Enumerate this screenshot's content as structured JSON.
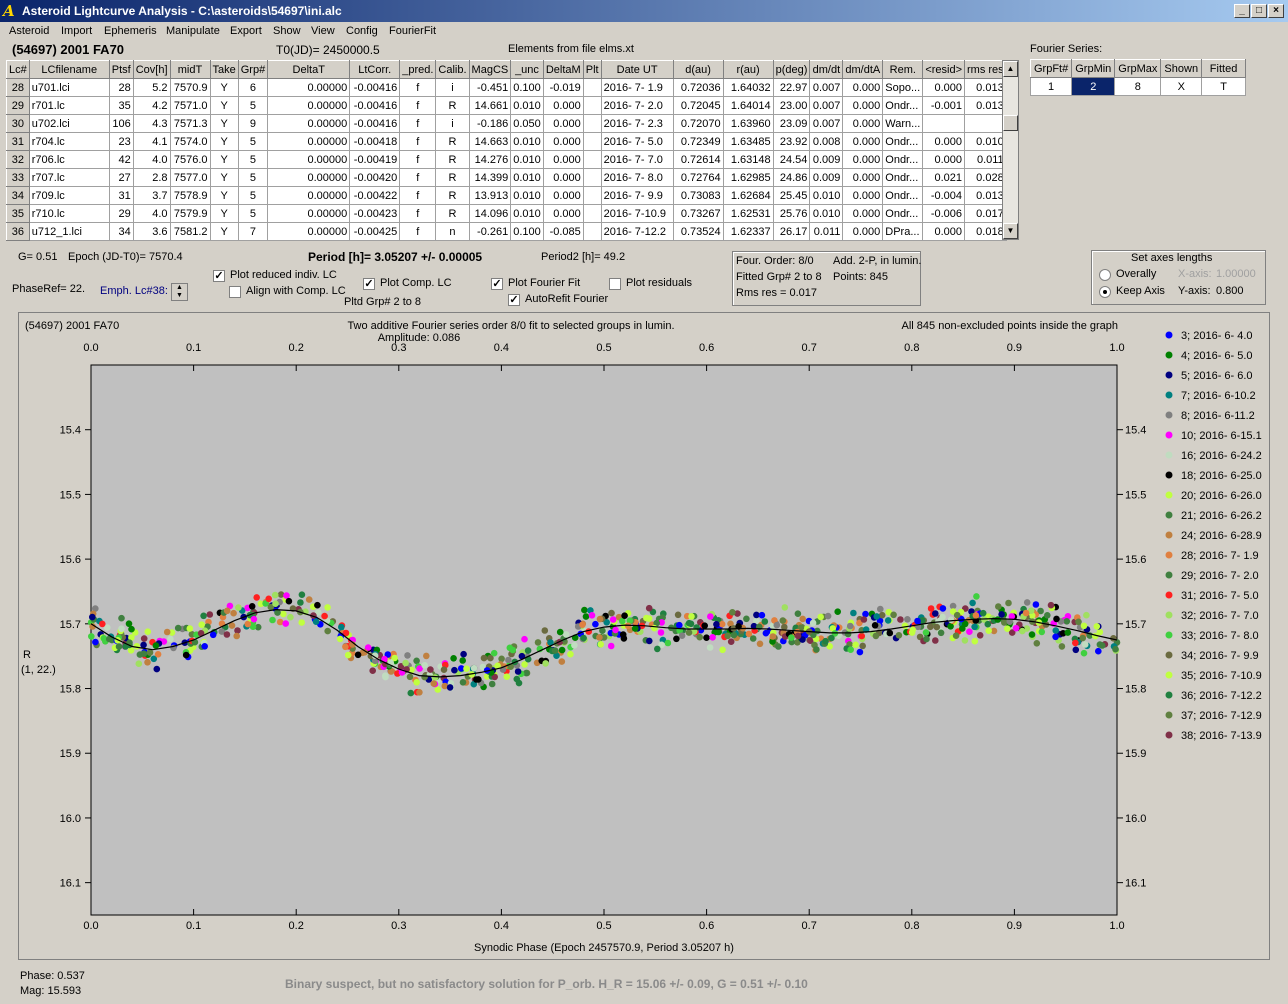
{
  "window": {
    "title": "Asteroid Lightcurve Analysis - C:\\asteroids\\54697\\ini.alc",
    "app_icon": "alc-app-icon",
    "buttons": [
      "_",
      "□",
      "×"
    ]
  },
  "menu": [
    "Asteroid",
    "Import",
    "Ephemeris",
    "Manipulate",
    "Export",
    "Show",
    "View",
    "Config",
    "FourierFit"
  ],
  "header": {
    "object": "(54697) 2001 FA70",
    "t0": "T0(JD)= 2450000.5",
    "elements": "Elements from file elms.xt",
    "fourier_label": "Fourier Series:"
  },
  "lc_table": {
    "columns": [
      "Lc#",
      "LCfilename",
      "Ptsf",
      "Cov[h]",
      "midT",
      "Take",
      "Grp#",
      "DeltaT",
      "LtCorr.",
      "_pred.",
      "Calib.",
      "MagCS",
      "_unc",
      "DeltaM",
      "Plt",
      "Date UT",
      "d(au)",
      "r(au)",
      "p(deg)",
      "dm/dt",
      "dm/dtA",
      "Rem.",
      "<resid>",
      "rms res"
    ],
    "rows": [
      [
        "28",
        "u701.lci",
        "28",
        "5.2",
        "7570.9",
        "Y",
        "6",
        "0.00000",
        "-0.00416",
        "f",
        "i",
        "-0.451",
        "0.100",
        "-0.019",
        "",
        "2016- 7- 1.9",
        "0.72036",
        "1.64032",
        "22.97",
        "0.007",
        "0.000",
        "Sopo...",
        "0.000",
        "0.013"
      ],
      [
        "29",
        "r701.lc",
        "35",
        "4.2",
        "7571.0",
        "Y",
        "5",
        "0.00000",
        "-0.00416",
        "f",
        "R",
        "14.661",
        "0.010",
        "0.000",
        "",
        "2016- 7- 2.0",
        "0.72045",
        "1.64014",
        "23.00",
        "0.007",
        "0.000",
        "Ondr...",
        "-0.001",
        "0.013"
      ],
      [
        "30",
        "u702.lci",
        "106",
        "4.3",
        "7571.3",
        "Y",
        "9",
        "0.00000",
        "-0.00416",
        "f",
        "i",
        "-0.186",
        "0.050",
        "0.000",
        "",
        "2016- 7- 2.3",
        "0.72070",
        "1.63960",
        "23.09",
        "0.007",
        "0.000",
        "Warn...",
        "",
        ""
      ],
      [
        "31",
        "r704.lc",
        "23",
        "4.1",
        "7574.0",
        "Y",
        "5",
        "0.00000",
        "-0.00418",
        "f",
        "R",
        "14.663",
        "0.010",
        "0.000",
        "",
        "2016- 7- 5.0",
        "0.72349",
        "1.63485",
        "23.92",
        "0.008",
        "0.000",
        "Ondr...",
        "0.000",
        "0.010"
      ],
      [
        "32",
        "r706.lc",
        "42",
        "4.0",
        "7576.0",
        "Y",
        "5",
        "0.00000",
        "-0.00419",
        "f",
        "R",
        "14.276",
        "0.010",
        "0.000",
        "",
        "2016- 7- 7.0",
        "0.72614",
        "1.63148",
        "24.54",
        "0.009",
        "0.000",
        "Ondr...",
        "0.000",
        "0.011"
      ],
      [
        "33",
        "r707.lc",
        "27",
        "2.8",
        "7577.0",
        "Y",
        "5",
        "0.00000",
        "-0.00420",
        "f",
        "R",
        "14.399",
        "0.010",
        "0.000",
        "",
        "2016- 7- 8.0",
        "0.72764",
        "1.62985",
        "24.86",
        "0.009",
        "0.000",
        "Ondr...",
        "0.021",
        "0.028"
      ],
      [
        "34",
        "r709.lc",
        "31",
        "3.7",
        "7578.9",
        "Y",
        "5",
        "0.00000",
        "-0.00422",
        "f",
        "R",
        "13.913",
        "0.010",
        "0.000",
        "",
        "2016- 7- 9.9",
        "0.73083",
        "1.62684",
        "25.45",
        "0.010",
        "0.000",
        "Ondr...",
        "-0.004",
        "0.013"
      ],
      [
        "35",
        "r710.lc",
        "29",
        "4.0",
        "7579.9",
        "Y",
        "5",
        "0.00000",
        "-0.00423",
        "f",
        "R",
        "14.096",
        "0.010",
        "0.000",
        "",
        "2016- 7-10.9",
        "0.73267",
        "1.62531",
        "25.76",
        "0.010",
        "0.000",
        "Ondr...",
        "-0.006",
        "0.017"
      ],
      [
        "36",
        "u712_1.lci",
        "34",
        "3.6",
        "7581.2",
        "Y",
        "7",
        "0.00000",
        "-0.00425",
        "f",
        "n",
        "-0.261",
        "0.100",
        "-0.085",
        "",
        "2016- 7-12.2",
        "0.73524",
        "1.62337",
        "26.17",
        "0.011",
        "0.000",
        "DPra...",
        "0.000",
        "0.018"
      ]
    ]
  },
  "fourier_table": {
    "columns": [
      "GrpFt#",
      "GrpMin",
      "GrpMax",
      "Shown",
      "Fitted"
    ],
    "row": [
      "1",
      "2",
      "8",
      "X",
      "T"
    ]
  },
  "controls": {
    "g": "G= 0.51",
    "epoch": "Epoch (JD-T0)= 7570.4",
    "period": "Period [h]= 3.05207 +/- 0.00005",
    "period2": "Period2 [h]= 49.2",
    "phaseref": "PhaseRef= 22.",
    "emph": "Emph. Lc#38:",
    "plot_reduced": "Plot reduced indiv. LC",
    "align": "Align with Comp. LC",
    "plot_comp": "Plot Comp. LC",
    "pltd_grp": "Pltd Grp#  2   to   8",
    "plot_fourier": "Plot Fourier Fit",
    "autorefit": "AutoRefit Fourier",
    "plot_resid": "Plot residuals",
    "plot_reduced_checked": true,
    "align_checked": false,
    "plot_comp_checked": true,
    "plot_fourier_checked": true,
    "autorefit_checked": true,
    "plot_resid_checked": false
  },
  "fit_info": {
    "order": "Four. Order:  8/0",
    "add": "Add. 2-P, in lumin.",
    "fitted": "Fitted Grp# 2 to 8",
    "points": "Points: 845",
    "rms": "Rms res      = 0.017"
  },
  "axes_box": {
    "title": "Set axes lengths",
    "overally": "Overally",
    "keep": "Keep Axis",
    "xaxis_label": "X-axis:",
    "xaxis_val": "1.00000",
    "yaxis_label": "Y-axis:",
    "yaxis_val": "0.800",
    "selected": "keep"
  },
  "status": {
    "phase": "Phase:  0.537",
    "mag": "Mag:    15.593",
    "message": "Binary suspect, but no satisfactory solution for P_orb.  H_R = 15.06 +/- 0.09, G = 0.51 +/- 0.10"
  },
  "chart_data": {
    "type": "scatter",
    "title": "(54697) 2001 FA70",
    "subtitle": "Two additive Fourier series order 8/0 fit to selected groups in lumin.",
    "amplitude": "Amplitude: 0.086",
    "note": "All 845 non-excluded points inside the graph",
    "xlabel": "Synodic Phase (Epoch 2457570.9, Period 3.05207 h)",
    "ylabel": "R",
    "ylabel2": "(1, 22.)",
    "xlim": [
      0,
      1
    ],
    "ylim": [
      15.3,
      16.15
    ],
    "y_inverted": true,
    "x_ticks": [
      "0.0",
      "0.1",
      "0.2",
      "0.3",
      "0.4",
      "0.5",
      "0.6",
      "0.7",
      "0.8",
      "0.9",
      "1.0"
    ],
    "y_ticks": [
      "15.4",
      "15.5",
      "15.6",
      "15.7",
      "15.8",
      "15.9",
      "16.0",
      "16.1"
    ],
    "fit_curve": {
      "x": [
        0.0,
        0.02,
        0.04,
        0.06,
        0.08,
        0.1,
        0.12,
        0.14,
        0.16,
        0.18,
        0.2,
        0.22,
        0.24,
        0.26,
        0.28,
        0.3,
        0.32,
        0.34,
        0.36,
        0.38,
        0.4,
        0.42,
        0.44,
        0.46,
        0.48,
        0.5,
        0.52,
        0.54,
        0.56,
        0.58,
        0.6,
        0.62,
        0.64,
        0.66,
        0.68,
        0.7,
        0.72,
        0.74,
        0.76,
        0.78,
        0.8,
        0.82,
        0.84,
        0.86,
        0.88,
        0.9,
        0.92,
        0.94,
        0.96,
        0.98,
        1.0
      ],
      "y": [
        15.7,
        15.72,
        15.735,
        15.74,
        15.735,
        15.725,
        15.71,
        15.695,
        15.683,
        15.678,
        15.68,
        15.69,
        15.71,
        15.735,
        15.755,
        15.77,
        15.78,
        15.782,
        15.78,
        15.775,
        15.768,
        15.755,
        15.74,
        15.725,
        15.712,
        15.705,
        15.702,
        15.703,
        15.706,
        15.708,
        15.708,
        15.708,
        15.707,
        15.708,
        15.71,
        15.712,
        15.714,
        15.714,
        15.712,
        15.708,
        15.703,
        15.698,
        15.695,
        15.693,
        15.692,
        15.693,
        15.697,
        15.703,
        15.71,
        15.718,
        15.725
      ]
    },
    "points_total": 845,
    "series": [
      {
        "name": "3; 2016- 6- 4.0",
        "color": "#0000ff"
      },
      {
        "name": "4; 2016- 6- 5.0",
        "color": "#008000"
      },
      {
        "name": "5; 2016- 6- 6.0",
        "color": "#000080"
      },
      {
        "name": "7; 2016- 6-10.2",
        "color": "#008080"
      },
      {
        "name": "8; 2016- 6-11.2",
        "color": "#808080"
      },
      {
        "name": "10; 2016- 6-15.1",
        "color": "#ff00ff"
      },
      {
        "name": "16; 2016- 6-24.2",
        "color": "#c0dcc0"
      },
      {
        "name": "18; 2016- 6-25.0",
        "color": "#000000"
      },
      {
        "name": "20; 2016- 6-26.0",
        "color": "#c0ff40"
      },
      {
        "name": "21; 2016- 6-26.2",
        "color": "#408040"
      },
      {
        "name": "24; 2016- 6-28.9",
        "color": "#c08040"
      },
      {
        "name": "28; 2016- 7- 1.9",
        "color": "#e08040"
      },
      {
        "name": "29; 2016- 7- 2.0",
        "color": "#408040"
      },
      {
        "name": "31; 2016- 7- 5.0",
        "color": "#ff2020"
      },
      {
        "name": "32; 2016- 7- 7.0",
        "color": "#a0e060"
      },
      {
        "name": "33; 2016- 7- 8.0",
        "color": "#40d040"
      },
      {
        "name": "34; 2016- 7- 9.9",
        "color": "#6b6b40"
      },
      {
        "name": "35; 2016- 7-10.9",
        "color": "#c0ff40"
      },
      {
        "name": "36; 2016- 7-12.2",
        "color": "#208040"
      },
      {
        "name": "37; 2016- 7-12.9",
        "color": "#608040"
      },
      {
        "name": "38; 2016- 7-13.9",
        "color": "#803048"
      }
    ]
  }
}
